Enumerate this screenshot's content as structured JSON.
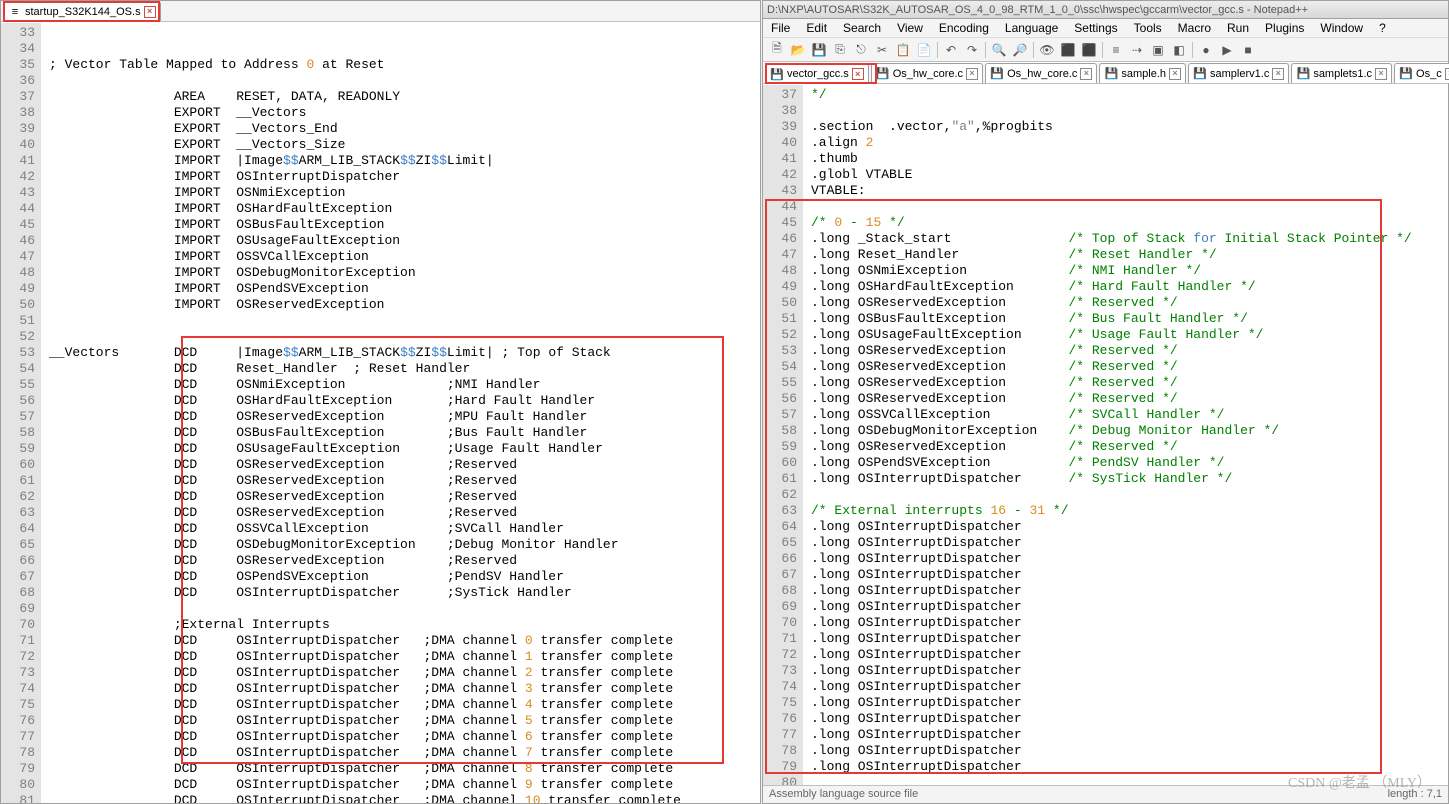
{
  "left": {
    "tab": {
      "name": "startup_S32K144_OS.s"
    },
    "lines_start": 33,
    "lines_end": 81,
    "code": [
      "",
      "",
      "; Vector Table Mapped to Address <n>0</n> at Reset",
      "",
      "                AREA    RESET, DATA, READONLY",
      "                EXPORT  __Vectors",
      "                EXPORT  __Vectors_End",
      "                EXPORT  __Vectors_Size",
      "                IMPORT  |Image<b>$$</b>ARM_LIB_STACK<b>$$</b>ZI<b>$$</b>Limit|",
      "                IMPORT  OSInterruptDispatcher",
      "                IMPORT  OSNmiException",
      "                IMPORT  OSHardFaultException",
      "                IMPORT  OSBusFaultException",
      "                IMPORT  OSUsageFaultException",
      "                IMPORT  OSSVCallException",
      "                IMPORT  OSDebugMonitorException",
      "                IMPORT  OSPendSVException",
      "                IMPORT  OSReservedException",
      "",
      "",
      "__Vectors       DCD     |Image<b>$$</b>ARM_LIB_STACK<b>$$</b>ZI<b>$$</b>Limit| ; Top of Stack",
      "                DCD     Reset_Handler  ; Reset Handler",
      "                DCD     OSNmiException             ;NMI Handler",
      "                DCD     OSHardFaultException       ;Hard Fault Handler",
      "                DCD     OSReservedException        ;MPU Fault Handler",
      "                DCD     OSBusFaultException        ;Bus Fault Handler",
      "                DCD     OSUsageFaultException      ;Usage Fault Handler",
      "                DCD     OSReservedException        ;Reserved",
      "                DCD     OSReservedException        ;Reserved",
      "                DCD     OSReservedException        ;Reserved",
      "                DCD     OSReservedException        ;Reserved",
      "                DCD     OSSVCallException          ;SVCall Handler",
      "                DCD     OSDebugMonitorException    ;Debug Monitor Handler",
      "                DCD     OSReservedException        ;Reserved",
      "                DCD     OSPendSVException          ;PendSV Handler",
      "                DCD     OSInterruptDispatcher      ;SysTick Handler",
      "",
      "                ;External Interrupts",
      "                DCD     OSInterruptDispatcher   ;DMA channel <n>0</n> transfer complete",
      "                DCD     OSInterruptDispatcher   ;DMA channel <n>1</n> transfer complete",
      "                DCD     OSInterruptDispatcher   ;DMA channel <n>2</n> transfer complete",
      "                DCD     OSInterruptDispatcher   ;DMA channel <n>3</n> transfer complete",
      "                DCD     OSInterruptDispatcher   ;DMA channel <n>4</n> transfer complete",
      "                DCD     OSInterruptDispatcher   ;DMA channel <n>5</n> transfer complete",
      "                DCD     OSInterruptDispatcher   ;DMA channel <n>6</n> transfer complete",
      "                DCD     OSInterruptDispatcher   ;DMA channel <n>7</n> transfer complete",
      "                DCD     OSInterruptDispatcher   ;DMA channel <n>8</n> transfer complete",
      "                DCD     OSInterruptDispatcher   ;DMA channel <n>9</n> transfer complete",
      "                DCD     OSInterruptDispatcher   ;DMA channel <n>10</n> transfer complete"
    ]
  },
  "right": {
    "title": "D:\\NXP\\AUTOSAR\\S32K_AUTOSAR_OS_4_0_98_RTM_1_0_0\\ssc\\hwspec\\gccarm\\vector_gcc.s - Notepad++",
    "menus": [
      "File",
      "Edit",
      "Search",
      "View",
      "Encoding",
      "Language",
      "Settings",
      "Tools",
      "Macro",
      "Run",
      "Plugins",
      "Window",
      "?"
    ],
    "tabs": [
      "vector_gcc.s",
      "Os_hw_core.c",
      "Os_hw_core.c",
      "sample.h",
      "samplerv1.c",
      "samplets1.c",
      "Os_c"
    ],
    "status_left": "Assembly language source file",
    "status_right": "length : 7,1",
    "lines_start": 37,
    "lines_end": 80,
    "code": [
      "<g>*/</g>",
      "",
      ".section  .vector,<s>\"a\"</s>,%progbits",
      ".align <n>2</n>",
      ".thumb",
      ".globl VTABLE",
      "VTABLE:",
      "",
      "<g>/*</g> <n>0</n> <g>-</g> <n>15</n> <g>*/</g>",
      ".long _Stack_start               <g>/* Top of Stack </g><bl>for</bl><g> Initial Stack Pointer */</g>",
      ".long Reset_Handler              <g>/* Reset Handler */</g>",
      ".long OSNmiException             <g>/* NMI Handler */</g>",
      ".long OSHardFaultException       <g>/* Hard Fault Handler */</g>",
      ".long OSReservedException        <g>/* Reserved */</g>",
      ".long OSBusFaultException        <g>/* Bus Fault Handler */</g>",
      ".long OSUsageFaultException      <g>/* Usage Fault Handler */</g>",
      ".long OSReservedException        <g>/* Reserved */</g>",
      ".long OSReservedException        <g>/* Reserved */</g>",
      ".long OSReservedException        <g>/* Reserved */</g>",
      ".long OSReservedException        <g>/* Reserved */</g>",
      ".long OSSVCallException          <g>/* SVCall Handler */</g>",
      ".long OSDebugMonitorException    <g>/* Debug Monitor Handler */</g>",
      ".long OSReservedException        <g>/* Reserved */</g>",
      ".long OSPendSVException          <g>/* PendSV Handler */</g>",
      ".long OSInterruptDispatcher      <g>/* SysTick Handler */</g>",
      "",
      "<g>/* External interrupts </g><n>16</n> <g>-</g> <n>31</n> <g>*/</g>",
      ".long OSInterruptDispatcher",
      ".long OSInterruptDispatcher",
      ".long OSInterruptDispatcher",
      ".long OSInterruptDispatcher",
      ".long OSInterruptDispatcher",
      ".long OSInterruptDispatcher",
      ".long OSInterruptDispatcher",
      ".long OSInterruptDispatcher",
      ".long OSInterruptDispatcher",
      ".long OSInterruptDispatcher",
      ".long OSInterruptDispatcher",
      ".long OSInterruptDispatcher",
      ".long OSInterruptDispatcher",
      ".long OSInterruptDispatcher",
      ".long OSInterruptDispatcher",
      ".long OSInterruptDispatcher",
      ""
    ]
  },
  "watermark": "CSDN @老孟 （MLY）"
}
